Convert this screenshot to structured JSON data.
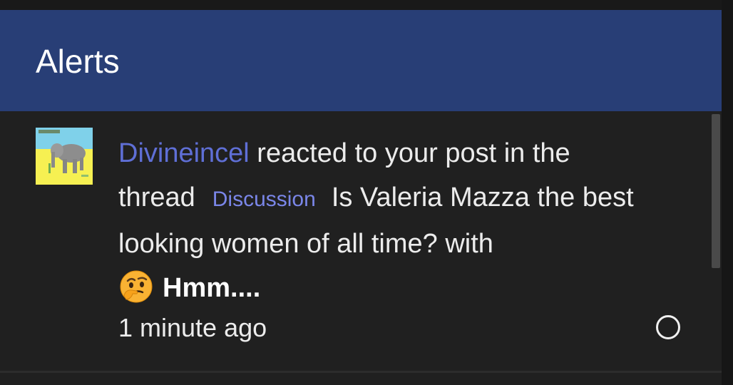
{
  "panel": {
    "title": "Alerts"
  },
  "alert": {
    "username": "Divineincel",
    "action_text": " reacted to your post in the thread",
    "prefix_label": "Discussion",
    "thread_title": "Is Valeria Mazza the best looking women of all time?",
    "with_text": " with",
    "reaction_label": "Hmm....",
    "reaction_icon": "thinking-face-emoji",
    "timestamp": "1 minute ago"
  },
  "colors": {
    "header_bg": "#283e76",
    "panel_bg": "#202020",
    "username": "#5f6fd6",
    "prefix": "#7a86e8",
    "text": "#ececec"
  }
}
